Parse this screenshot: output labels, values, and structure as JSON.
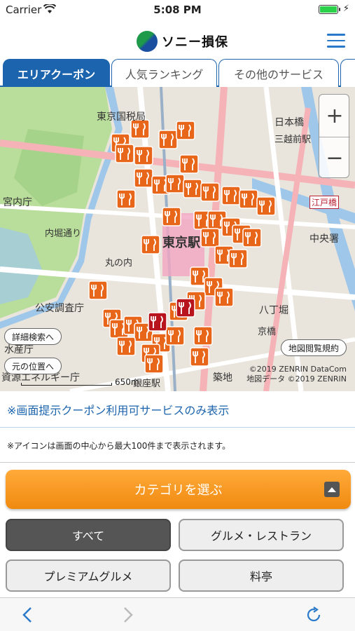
{
  "status": {
    "carrier": "Carrier",
    "time": "5:08 PM"
  },
  "header": {
    "logo_text": "ソニー損保"
  },
  "tabs": [
    {
      "label": "エリアクーポン",
      "active": true
    },
    {
      "label": "人気ランキング",
      "active": false
    },
    {
      "label": "その他のサービス",
      "active": false
    }
  ],
  "map": {
    "zoom_in": "+",
    "zoom_out": "−",
    "detail_search": "詳細検索へ",
    "reset_position": "元の位置へ",
    "terms": "地図閲覧規約",
    "copyright_1": "©2019 ZENRIN DataCom",
    "copyright_2": "地図データ ©2019 ZENRIN",
    "scale_label": "650m",
    "labels": {
      "tokyo_station": "東京駅",
      "kokuzei": "東京国税局",
      "nihonbashi": "日本橋",
      "kunaicho": "宮内庁",
      "uchibori": "内堀通り",
      "koan": "公安調査庁",
      "suisan": "水産庁",
      "energy": "資源エネルギー庁",
      "ginza": "銀座駅",
      "hatchobori": "八丁堀",
      "kyobashi": "京橋",
      "chuo": "中央署",
      "edobashi": "江戸橋",
      "mitsukoshi": "三越前駅",
      "marunouchi": "丸の内",
      "tsukiji": "築地"
    }
  },
  "notice": {
    "coupon_only": "※画面提示クーポン利用可サービスのみ表示",
    "icon_limit": "※アイコンは画面の中心から最大100件まで表示されます。"
  },
  "category": {
    "select_label": "カテゴリを選ぶ",
    "options": [
      {
        "label": "すべて",
        "active": true
      },
      {
        "label": "グルメ・レストラン",
        "active": false
      },
      {
        "label": "プレミアムグルメ",
        "active": false
      },
      {
        "label": "料亭",
        "active": false
      }
    ]
  },
  "colors": {
    "brand_blue": "#1c64ad",
    "accent_orange": "#f08a10",
    "pin_orange": "#e8661a",
    "pin_red": "#b8141e"
  }
}
